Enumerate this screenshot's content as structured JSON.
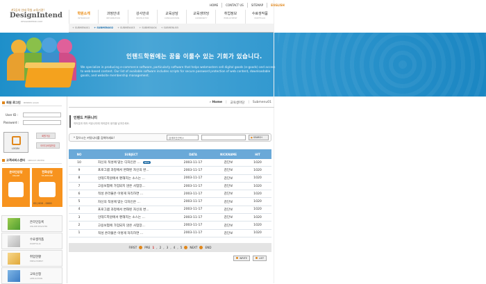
{
  "logo": {
    "tagline": "#1등의 인테 학원 교육기관!",
    "name": "DesignIntend",
    "sub": "DESIGNINTEND.COM"
  },
  "util_links": [
    "HOME",
    "CONTACT US",
    "SITEMAP",
    "ENGLISH"
  ],
  "gnb": [
    {
      "ko": "학원소개",
      "en": "INTRODUCE",
      "active": true
    },
    {
      "ko": "과정안내",
      "en": "INFORMATION"
    },
    {
      "ko": "강사안내",
      "en": "INSTRUCTOR"
    },
    {
      "ko": "교육상담",
      "en": "CONSULTATION"
    },
    {
      "ko": "교육생마당",
      "en": "COMMUNITY"
    },
    {
      "ko": "취업정보",
      "en": "EMPLOYMENT"
    },
    {
      "ko": "수료생작품",
      "en": "PORTFOLIO"
    }
  ],
  "subnav": [
    "SUBMENU01",
    "SUBMENU02",
    "SUBMENU03",
    "SUBMENU04",
    "SUBMENU05"
  ],
  "banner": {
    "title": "인텐드학원에는 꿈을 이룰수 있는 기회가 있습니다.",
    "desc": "We specialize in producing e-commerce software, particularly software that helps webmasters sell digital goods (e-goods) and access to web-based content. Our list of available software includes scripts for secure password protection of web content, downloadable goods, and website membership management."
  },
  "login": {
    "title": "회원 로그인",
    "title_en": "MEMBER LOGIN",
    "id_label": "User ID :",
    "pw_label": "Password :",
    "login_btn": "LOGIN",
    "join_btn": "회원가입",
    "find_btn": "아이디/비밀번호"
  },
  "service": {
    "title": "고객서비스센터",
    "title_en": "SERVICE CENTER",
    "online": "온라인상담",
    "online_en": "ONLINE",
    "phone": "전화상담",
    "phone_en": "TELEPHONE",
    "phone_number": "02) 000 - 0000"
  },
  "quick_cards": [
    {
      "label": "온라인등록",
      "en": "ONLINE REGISTER"
    },
    {
      "label": "수료생작품",
      "en": "PORTFOLIO"
    },
    {
      "label": "취업현황",
      "en": "EMPLOYMENT"
    },
    {
      "label": "교육신청",
      "en": "APPLICATION"
    }
  ],
  "breadcrumb": {
    "home": "Home",
    "path1": "교육생마당",
    "path2": "Submenu01"
  },
  "section": {
    "title": "인텐드 커뮤니티",
    "desc": "여러분과 여러 커뮤니티에 여러분의 생각을 남겨주세요."
  },
  "search": {
    "label": "찾으시는 커뮤니티를 검색하세요!",
    "select": "검색조건선택",
    "button": "SEARCH"
  },
  "table": {
    "headers": {
      "no": "NO",
      "subject": "SUBJECT",
      "data": "DATA",
      "nickname": "NICKNAME",
      "hit": "HIT"
    },
    "rows": [
      {
        "no": "10",
        "subject": "자신의 적성에 맞는 디자인은 ...",
        "date": "2003-11-17",
        "nick": "감단보",
        "hit": "1020",
        "new": true
      },
      {
        "no": "9",
        "subject": "프로그램 과정에서 변화된 자신의 변...",
        "date": "2003-11-17",
        "nick": "감단보",
        "hit": "1020"
      },
      {
        "no": "8",
        "subject": "인테드학원에서 편해지는 소스는 ...",
        "date": "2003-11-17",
        "nick": "감단보",
        "hit": "1020"
      },
      {
        "no": "7",
        "subject": "고용보험에 가입되지 않은 사업장...",
        "date": "2003-11-17",
        "nick": "감단보",
        "hit": "1020"
      },
      {
        "no": "6",
        "subject": "적성 온라불은 이렇게 처리하면 ...",
        "date": "2003-11-17",
        "nick": "감단보",
        "hit": "1020"
      },
      {
        "no": "5",
        "subject": "자신의 적성에 맞는 디자인은 ...",
        "date": "2003-11-17",
        "nick": "감단보",
        "hit": "1020"
      },
      {
        "no": "4",
        "subject": "프로그램 과정에서 변화된 자신의 변...",
        "date": "2003-11-17",
        "nick": "감단보",
        "hit": "1020"
      },
      {
        "no": "3",
        "subject": "인테드학원에서 편해지는 소스는 ...",
        "date": "2003-11-17",
        "nick": "감단보",
        "hit": "1020"
      },
      {
        "no": "2",
        "subject": "고용보험에 가입되지 않은 사업장...",
        "date": "2003-11-17",
        "nick": "감단보",
        "hit": "1020"
      },
      {
        "no": "1",
        "subject": "적성 온라불은 이렇게 처리하면 ...",
        "date": "2003-11-17",
        "nick": "감단보",
        "hit": "1020"
      }
    ],
    "new_badge": "NEW"
  },
  "pager": {
    "first": "FIRST",
    "pre": "PRE",
    "pages": [
      "1",
      "2",
      "3",
      "4",
      "5"
    ],
    "current": "1",
    "next": "NEXT",
    "end": "END"
  },
  "buttons": {
    "write": "WRITE",
    "list": "LIST"
  },
  "colors": {
    "accent": "#e0861a",
    "banner": "#2f97cf",
    "table_head": "#6aa9d8"
  }
}
